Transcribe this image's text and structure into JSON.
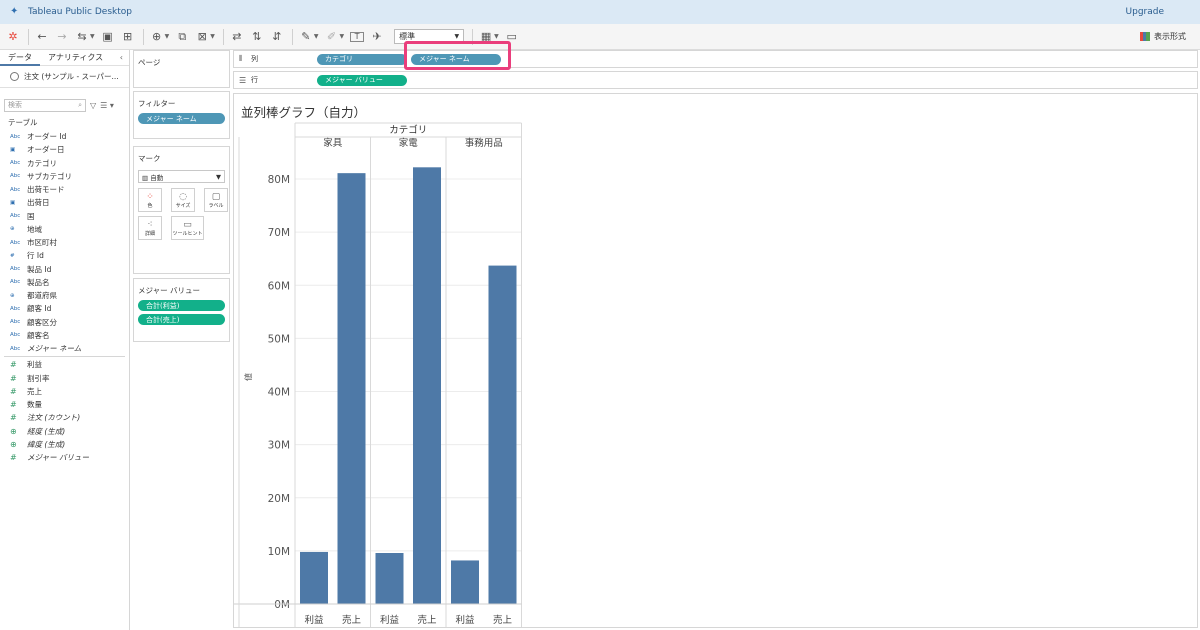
{
  "app": {
    "title": "Tableau Public Desktop",
    "upgrade": "Upgrade"
  },
  "toolbar": {
    "fit": "標準",
    "show_me": "表示形式"
  },
  "data_pane": {
    "tabs": [
      "データ",
      "アナリティクス"
    ],
    "datasource": "注文 (サンプル - スーパー...",
    "search_placeholder": "検索",
    "section": "テーブル",
    "dimensions": [
      {
        "type": "Abc",
        "name": "オーダー Id"
      },
      {
        "type": "date",
        "name": "オーダー日"
      },
      {
        "type": "Abc",
        "name": "カテゴリ"
      },
      {
        "type": "Abc",
        "name": "サブカテゴリ"
      },
      {
        "type": "Abc",
        "name": "出荷モード"
      },
      {
        "type": "date",
        "name": "出荷日"
      },
      {
        "type": "Abc",
        "name": "国"
      },
      {
        "type": "geo",
        "name": "地域"
      },
      {
        "type": "Abc",
        "name": "市区町村"
      },
      {
        "type": "num",
        "name": "行 Id"
      },
      {
        "type": "Abc",
        "name": "製品 Id"
      },
      {
        "type": "Abc",
        "name": "製品名"
      },
      {
        "type": "geo",
        "name": "都道府県"
      },
      {
        "type": "Abc",
        "name": "顧客 Id"
      },
      {
        "type": "Abc",
        "name": "顧客区分"
      },
      {
        "type": "Abc",
        "name": "顧客名"
      },
      {
        "type": "Abc",
        "name": "メジャー ネーム",
        "italic": true
      }
    ],
    "measures": [
      {
        "type": "num",
        "name": "利益"
      },
      {
        "type": "num",
        "name": "割引率"
      },
      {
        "type": "num",
        "name": "売上"
      },
      {
        "type": "num",
        "name": "数量"
      },
      {
        "type": "num",
        "name": "注文 (カウント)",
        "italic": true
      },
      {
        "type": "geo",
        "name": "経度 (生成)",
        "italic": true
      },
      {
        "type": "geo",
        "name": "緯度 (生成)",
        "italic": true
      },
      {
        "type": "num",
        "name": "メジャー バリュー",
        "italic": true
      }
    ]
  },
  "cards": {
    "pages": "ページ",
    "filters": {
      "title": "フィルター",
      "pill": "メジャー ネーム"
    },
    "marks": {
      "title": "マーク",
      "type": "自動",
      "buttons": [
        "色",
        "サイズ",
        "ラベル",
        "詳細",
        "ツールヒント"
      ]
    },
    "measure_values": {
      "title": "メジャー バリュー",
      "pills": [
        "合計(利益)",
        "合計(売上)"
      ]
    }
  },
  "shelves": {
    "columns": {
      "label": "列",
      "pills": [
        "カテゴリ",
        "メジャー ネーム"
      ]
    },
    "rows": {
      "label": "行",
      "pills": [
        "メジャー バリュー"
      ]
    }
  },
  "viz": {
    "title": "並列棒グラフ（自力）"
  },
  "chart_data": {
    "type": "bar",
    "title": "",
    "header": "カテゴリ",
    "categories": [
      "家具",
      "家電",
      "事務用品"
    ],
    "measures": [
      "利益",
      "売上"
    ],
    "ylabel": "値",
    "ylim": [
      0,
      80000000
    ],
    "yticks": [
      "0M",
      "10M",
      "20M",
      "30M",
      "40M",
      "50M",
      "60M",
      "70M",
      "80M"
    ],
    "values": [
      {
        "category": "家具",
        "利益": 9800000,
        "売上": 81100000
      },
      {
        "category": "家電",
        "利益": 9600000,
        "売上": 82200000
      },
      {
        "category": "事務用品",
        "利益": 8200000,
        "売上": 63700000
      }
    ],
    "bar_color": "#4e79a7"
  }
}
